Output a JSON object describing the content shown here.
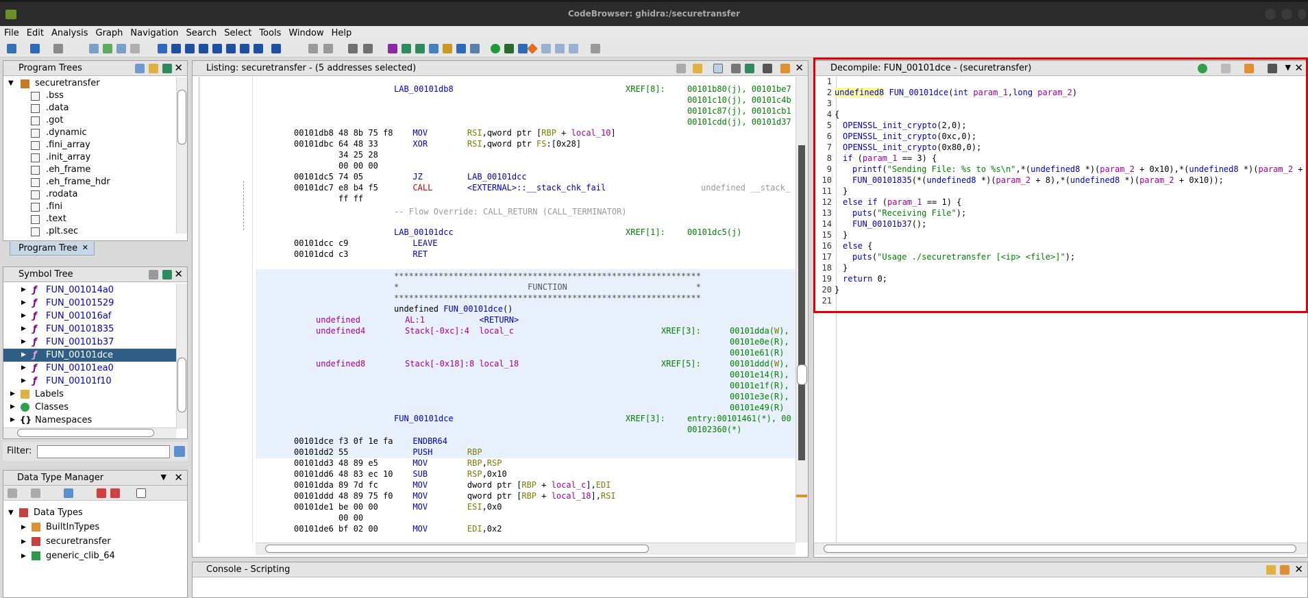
{
  "window": {
    "title": "CodeBrowser: ghidra:/securetransfer"
  },
  "menu": [
    "File",
    "Edit",
    "Analysis",
    "Graph",
    "Navigation",
    "Search",
    "Select",
    "Tools",
    "Window",
    "Help"
  ],
  "program_trees": {
    "title": "Program Trees",
    "root": "securetransfer",
    "sections": [
      ".bss",
      ".data",
      ".got",
      ".dynamic",
      ".fini_array",
      ".init_array",
      ".eh_frame",
      ".eh_frame_hdr",
      ".rodata",
      ".fini",
      ".text",
      ".plt.sec"
    ],
    "tab": "Program Tree"
  },
  "symbol_tree": {
    "title": "Symbol Tree",
    "functions": [
      "FUN_001014a0",
      "FUN_00101529",
      "FUN_001016af",
      "FUN_00101835",
      "FUN_00101b37",
      "FUN_00101dce",
      "FUN_00101ea0",
      "FUN_00101f10"
    ],
    "groups": [
      "Labels",
      "Classes",
      "Namespaces"
    ],
    "filter_label": "Filter:"
  },
  "data_type_manager": {
    "title": "Data Type Manager",
    "root": "Data Types",
    "items": [
      "BuiltInTypes",
      "securetransfer",
      "generic_clib_64"
    ]
  },
  "listing": {
    "title": "Listing:  securetransfer - (5 addresses selected)"
  },
  "decompile": {
    "title": "Decompile: FUN_00101dce -  (securetransfer)"
  },
  "console": {
    "title": "Console - Scripting"
  },
  "colors": {
    "selection": "#2f5f86",
    "red_box": "#e00000",
    "func_bg": "#e8f0fb"
  }
}
